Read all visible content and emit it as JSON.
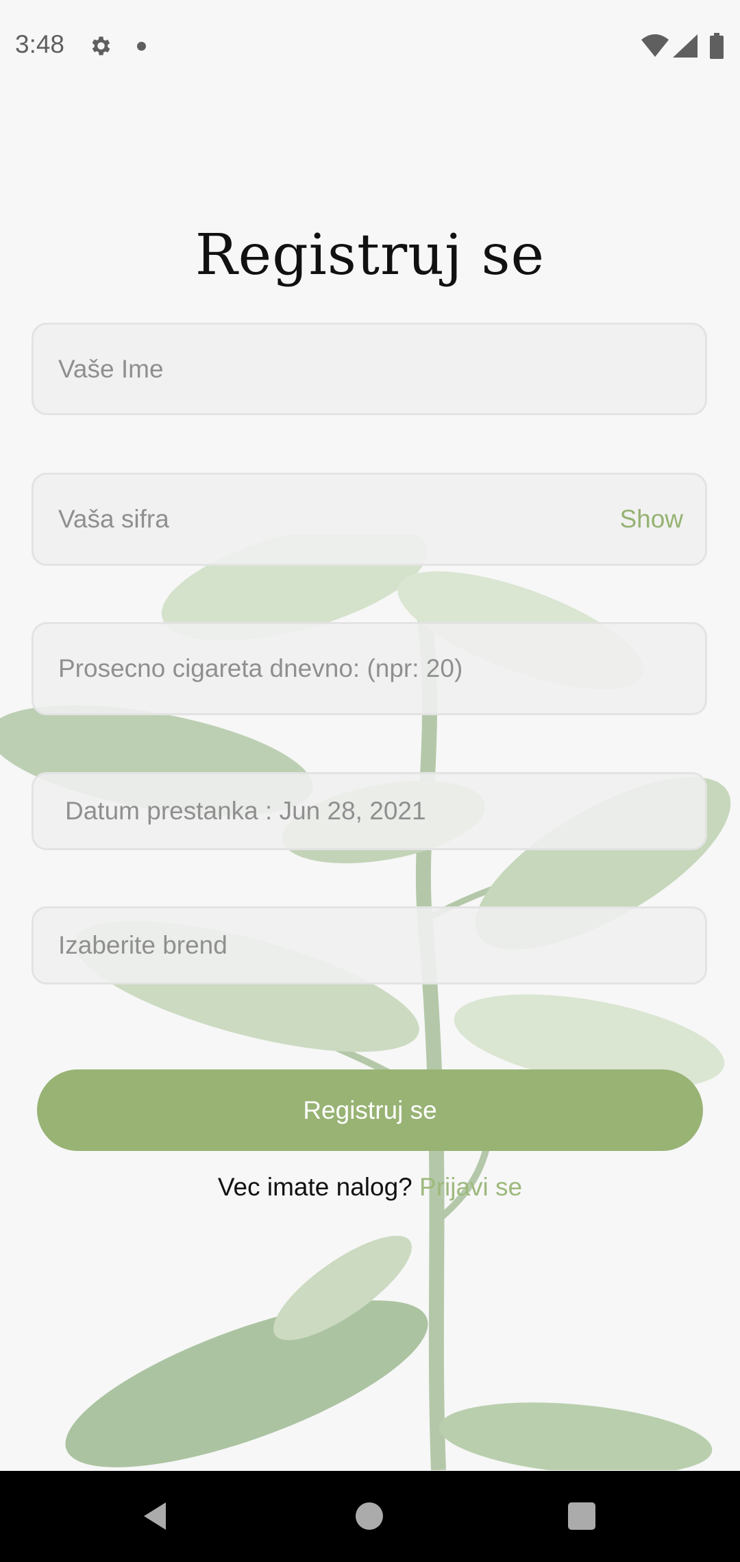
{
  "status_bar": {
    "time": "3:48",
    "icons": [
      "gear-icon",
      "notification-dot-icon",
      "wifi-icon",
      "signal-icon",
      "battery-icon"
    ]
  },
  "title": "Registruj se",
  "fields": {
    "name_placeholder": "Vaše Ime",
    "password_placeholder": "Vaša sifra",
    "password_toggle": "Show",
    "cigarettes_placeholder": "Prosecno cigareta dnevno: (npr: 20)",
    "quit_date": "Datum prestanka : Jun 28, 2021",
    "brand_placeholder": "Izaberite brend"
  },
  "register_button": "Registruj se",
  "login_prompt": {
    "text": "Vec imate nalog? ",
    "link": "Prijavi se"
  },
  "colors": {
    "accent": "#98b374",
    "link": "#9db97c",
    "background": "#f7f7f7"
  },
  "nav_bar": [
    "back-icon",
    "home-icon",
    "recents-icon"
  ]
}
